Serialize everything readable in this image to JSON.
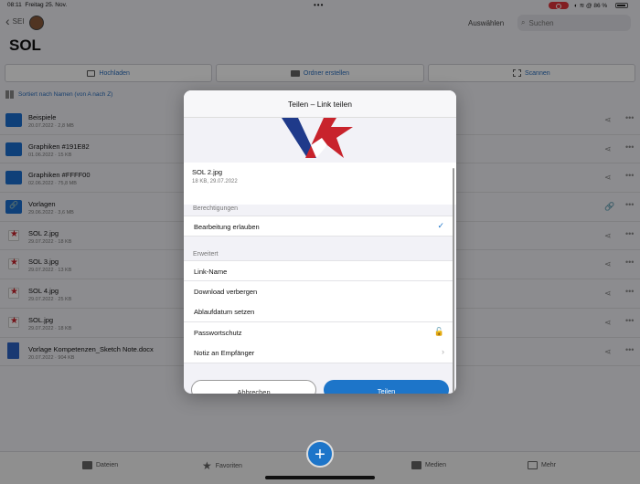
{
  "status_bar": {
    "time": "08:11",
    "date": "Freitag 25. Nov.",
    "battery": "86 %"
  },
  "nav": {
    "back_label": "SEI",
    "select_label": "Auswählen",
    "search_placeholder": "Suchen"
  },
  "page_title": "SOL",
  "actions": {
    "upload": "Hochladen",
    "create_folder": "Ordner erstellen",
    "scan": "Scannen"
  },
  "sort_label": "Sortiert nach Namen (von A nach Z)",
  "files": [
    {
      "name": "Beispiele",
      "meta": "20.07.2022 · 2,8 MB",
      "kind": "folder"
    },
    {
      "name": "Graphiken #191E82",
      "meta": "01.06.2022 · 15 KB",
      "kind": "folder"
    },
    {
      "name": "Graphiken #FFFF00",
      "meta": "02.06.2022 · 75,8 MB",
      "kind": "folder"
    },
    {
      "name": "Vorlagen",
      "meta": "29.06.2022 · 3,6 MB",
      "kind": "link"
    },
    {
      "name": "SOL 2.jpg",
      "meta": "29.07.2022 · 18 KB",
      "kind": "image"
    },
    {
      "name": "SOL 3.jpg",
      "meta": "29.07.2022 · 13 KB",
      "kind": "image"
    },
    {
      "name": "SOL 4.jpg",
      "meta": "29.07.2022 · 25 KB",
      "kind": "image"
    },
    {
      "name": "SOL.jpg",
      "meta": "29.07.2022 · 18 KB",
      "kind": "image"
    },
    {
      "name": "Vorlage Kompetenzen_Sketch Note.docx",
      "meta": "20.07.2022 · 904 KB",
      "kind": "doc"
    }
  ],
  "tabbar": {
    "files": "Dateien",
    "favorites": "Favoriten",
    "media": "Medien",
    "more": "Mehr"
  },
  "modal": {
    "title": "Teilen – Link teilen",
    "file_name": "SOL 2.jpg",
    "file_meta": "18 KB, 29.07.2022",
    "permissions_header": "Berechtigungen",
    "allow_edit": "Bearbeitung erlauben",
    "advanced_header": "Erweitert",
    "options": [
      "Link-Name",
      "Download verbergen",
      "Ablaufdatum setzen",
      "Passwortschutz",
      "Notiz an Empfänger"
    ],
    "cancel": "Abbrechen",
    "share": "Teilen"
  },
  "colors": {
    "accent": "#1d75c9",
    "folder": "#1a6ed0",
    "logo_red": "#c8232c",
    "logo_blue": "#1f3a8a"
  }
}
